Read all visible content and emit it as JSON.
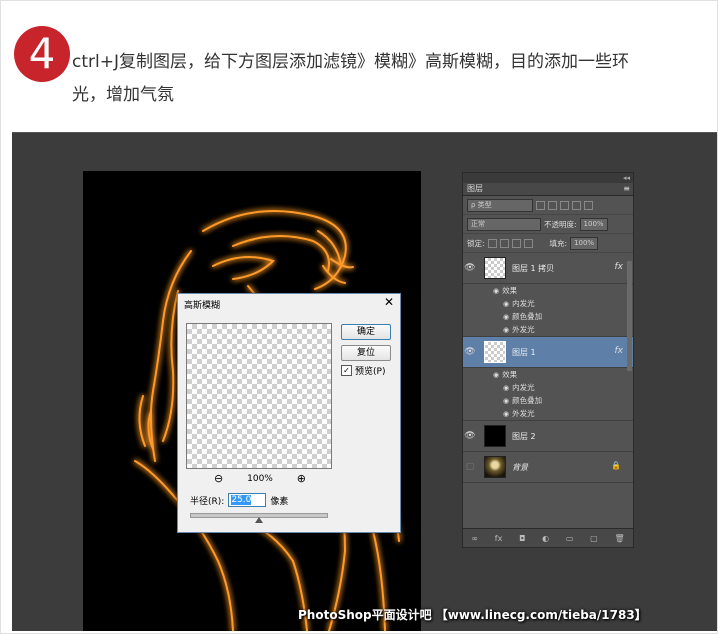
{
  "step": {
    "number": "4"
  },
  "instruction": {
    "line1": "ctrl+J复制图层，给下方图层添加滤镜》模糊》高斯模糊，目的添加一些环",
    "line2": "光，增加气氛"
  },
  "dialog": {
    "title": "高斯模糊",
    "close": "✕",
    "ok_label": "确定",
    "reset_label": "复位",
    "preview_label": "预览(P)",
    "preview_checked": "✓",
    "zoom_out": "⊖",
    "zoom_level": "100%",
    "zoom_in": "⊕",
    "radius_label": "半径(R):",
    "radius_value": "25.0",
    "radius_unit": "像素",
    "slider_fraction": 0.5
  },
  "layers_panel": {
    "collapse": "◂◂",
    "tab_label": "图层",
    "menu_icon": "≡",
    "filter_kind": "ρ 类型",
    "blend_mode": "正常",
    "opacity_label": "不透明度:",
    "opacity_value": "100%",
    "lock_label": "锁定:",
    "fill_label": "填充:",
    "fill_value": "100%",
    "layers": [
      {
        "name": "图层 1 拷贝",
        "fx": "fx",
        "effects_label": "效果",
        "effects": [
          "内发光",
          "颜色叠加",
          "外发光"
        ]
      },
      {
        "name": "图层 1",
        "fx": "fx",
        "effects_label": "效果",
        "effects": [
          "内发光",
          "颜色叠加",
          "外发光"
        ]
      },
      {
        "name": "图层 2"
      },
      {
        "name": "背景",
        "lock": "🔒"
      }
    ],
    "bottom_icons": [
      "link-icon",
      "fx-icon",
      "mask-icon",
      "adjustment-icon",
      "group-icon",
      "new-layer-icon",
      "trash-icon"
    ],
    "bottom_glyphs": [
      "∞",
      "fx",
      "◘",
      "◐",
      "▭",
      "▢",
      "🗑"
    ]
  },
  "watermark": "PhotoShop平面设计吧 【www.linecg.com/tieba/1783】",
  "colors": {
    "badge": "#c8242b",
    "glow": "#ff8a1a",
    "active_layer": "#5e7fa8"
  }
}
